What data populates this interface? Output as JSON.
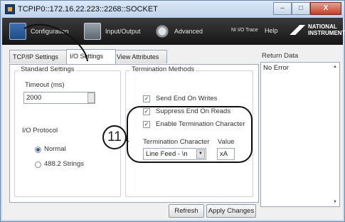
{
  "window": {
    "title": "TCPIP0::172.16.22.223::2268::SOCKET",
    "min": "–",
    "max": "□",
    "close": "X"
  },
  "toolbar": {
    "configuration": "Configuration",
    "input_output": "Input/Output",
    "advanced": "Advanced",
    "ni_io_trace": "NI I/O Trace",
    "help": "Help",
    "brand_line1": "NATIONAL",
    "brand_line2": "INSTRUMENTS"
  },
  "tabs": [
    "TCP/IP Settings",
    "I/O Settings",
    "View Attributes"
  ],
  "standard": {
    "title": "Standard Settings",
    "timeout_label": "Timeout (ms)",
    "timeout_value": "2000",
    "protocol_label": "I/O Protocol",
    "options": [
      "Normal",
      "488.2 Strings"
    ],
    "selected": "Normal"
  },
  "termination": {
    "title": "Termination Methods",
    "send_end": "Send End On Writes",
    "suppress_end": "Suppress End On Reads",
    "enable_term": "Enable Termination Character",
    "char_label": "Termination Character",
    "char_value": "Line Feed - \\n",
    "value_label": "Value",
    "value_value": "xA"
  },
  "return_data": {
    "label": "Return Data",
    "value": "No Error"
  },
  "buttons": {
    "refresh": "Refresh",
    "apply": "Apply Changes"
  },
  "callout": "11"
}
